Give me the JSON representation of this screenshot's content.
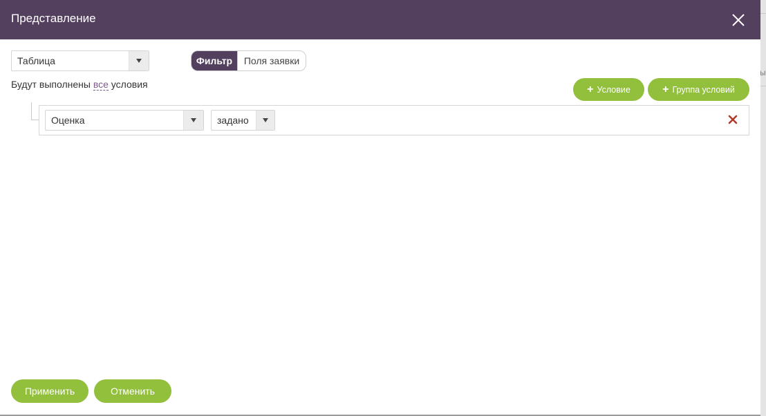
{
  "dialog": {
    "title": "Представление",
    "header_color": "#533f5e"
  },
  "view_select": {
    "value": "Таблица"
  },
  "tabs": [
    {
      "label": "Фильтр",
      "active": true
    },
    {
      "label": "Поля заявки",
      "active": false
    }
  ],
  "conditions_text": {
    "before": "Будут выполнены",
    "link": "все",
    "after": "условия"
  },
  "actions": {
    "add_condition": "Условие",
    "add_group": "Группа условий",
    "plus_icon": "plus-icon"
  },
  "condition": {
    "field": "Оценка",
    "operator": "задано",
    "remove_icon": "remove-icon"
  },
  "footer": {
    "apply": "Применить",
    "cancel": "Отменить"
  },
  "background_fragment": "ы",
  "colors": {
    "accent": "#92c03d",
    "header": "#533f5e",
    "remove": "#c0392b"
  }
}
